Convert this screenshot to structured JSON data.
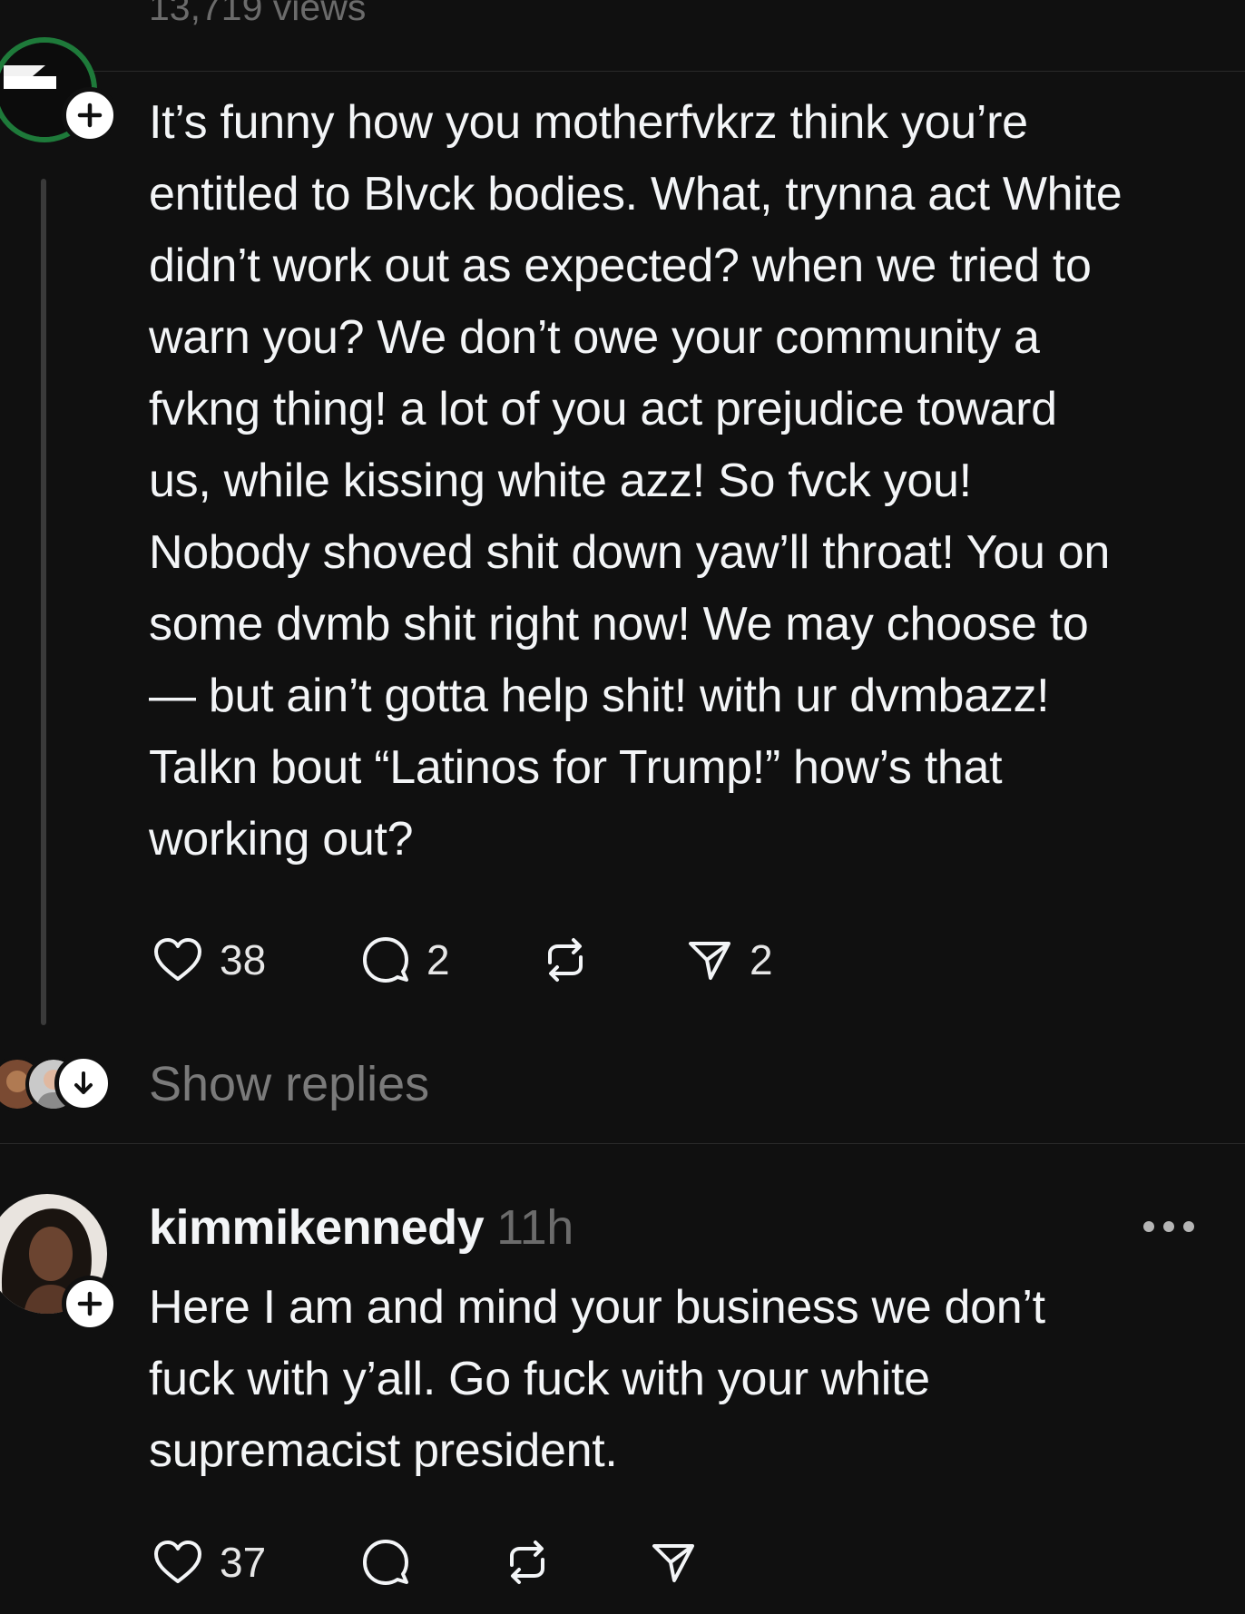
{
  "header": {
    "views": "13,719 views"
  },
  "post1": {
    "lines": [
      "It’s funny how you motherfvkrz think you’re",
      "entitled to Blvck bodies. What, trynna act White",
      "didn’t work out as expected? when we tried to",
      "warn you? We don’t owe your community a",
      "fvkng thing! a lot of you act prejudice toward",
      "us, while kissing white azz! So fvck you!",
      "Nobody shoved shit down yaw’ll throat! You on",
      "some dvmb shit right now! We may choose to",
      "— but ain’t gotta help shit! with ur dvmbazz!",
      "Talkn bout “Latinos for Trump!” how’s that",
      "working out?"
    ],
    "likes": "38",
    "replies": "2",
    "shares": "2",
    "show_replies": "Show replies"
  },
  "post2": {
    "username": "kimmikennedy",
    "time": "11h",
    "lines": [
      "Here I am and mind your business we don’t",
      "fuck with y’all. Go fuck with your white",
      "supremacist president."
    ],
    "likes": "37"
  },
  "icons": {
    "like": "heart-icon",
    "reply": "comment-icon",
    "repost": "repost-icon",
    "share": "send-icon",
    "follow": "plus-icon",
    "expand": "arrow-down-icon",
    "more": "more-dots-icon"
  },
  "colors": {
    "background": "#101010",
    "text": "#f3f5f7",
    "muted": "#6b6b6b",
    "avatar_ring": "#1e7a3a"
  }
}
